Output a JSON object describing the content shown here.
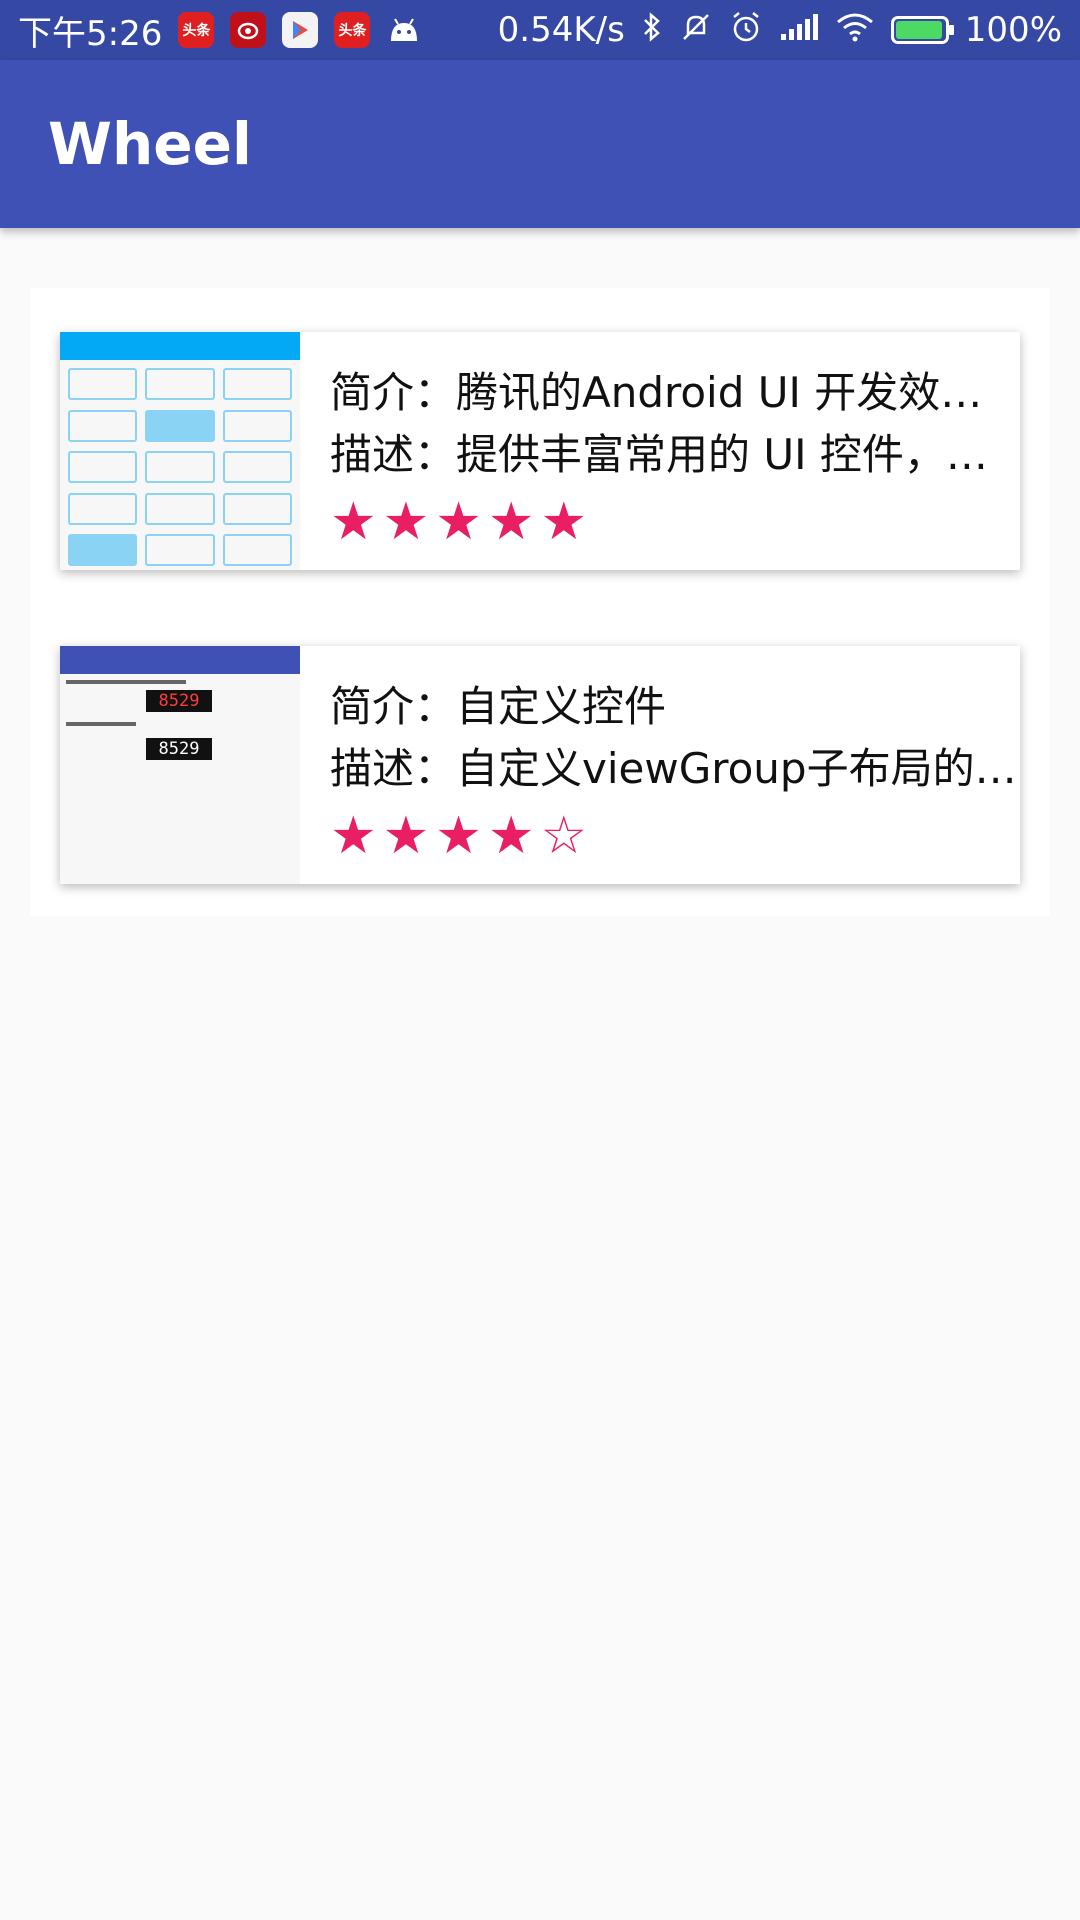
{
  "status_bar": {
    "time": "下午5:26",
    "notification_icons": [
      "toutiao-icon",
      "weibo-icon",
      "play-store-icon",
      "toutiao-icon",
      "android-icon"
    ],
    "network_speed": "0.54K/s",
    "battery": "100%",
    "battery_level": 1.0,
    "toutiao_label": "头条"
  },
  "app_bar": {
    "title": "Wheel"
  },
  "items": [
    {
      "intro": "简介：腾讯的Android UI 开发效率…",
      "desc": "描述：提供丰富常用的 UI 控件，…",
      "rating": 5,
      "max_rating": 5,
      "thumb_icon": "component-list-screenshot"
    },
    {
      "intro": "简介：自定义控件",
      "desc": "描述：自定义viewGroup子布局的…",
      "rating": 4,
      "max_rating": 5,
      "thumb_icon": "custom-view-screenshot",
      "thumb_numbers": [
        "8529",
        "8529"
      ]
    }
  ],
  "colors": {
    "primary": "#3f51b5",
    "primary_dark": "#3548a3",
    "star": "#e91e63"
  }
}
